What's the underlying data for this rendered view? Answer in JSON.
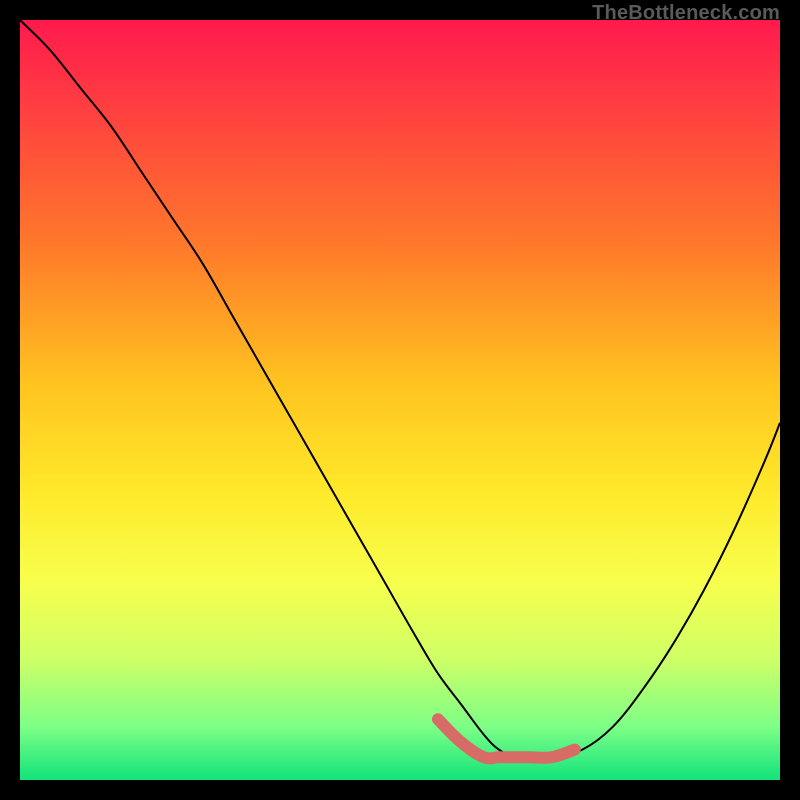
{
  "watermark": "TheBottleneck.com",
  "colors": {
    "gradient_stops": [
      "#ff1a4d 0%",
      "#ff4040 12%",
      "#ff7a2a 30%",
      "#ffc41f 48%",
      "#ffe92a 62%",
      "#f7ff4d 74%",
      "#cfff66 84%",
      "#7dff87 93%",
      "#12e37a 100%"
    ],
    "curve": "#000000",
    "highlight": "#d76b66",
    "frame": "#000000"
  },
  "chart_data": {
    "type": "line",
    "title": "",
    "xlabel": "",
    "ylabel": "",
    "xlim": [
      0,
      100
    ],
    "ylim": [
      0,
      100
    ],
    "series": [
      {
        "name": "bottleneck-curve",
        "x": [
          0,
          4,
          8,
          12,
          16,
          20,
          24,
          28,
          32,
          36,
          40,
          44,
          48,
          52,
          55,
          58,
          61,
          63,
          65,
          67,
          70,
          74,
          78,
          82,
          86,
          90,
          94,
          98,
          100
        ],
        "values": [
          100,
          96,
          91,
          86,
          80,
          74,
          68,
          61,
          54,
          47,
          40,
          33,
          26,
          19,
          14,
          10,
          6,
          4,
          3,
          3,
          3,
          4,
          7,
          12,
          18,
          25,
          33,
          42,
          47
        ]
      }
    ],
    "highlight_range": {
      "name": "optimal-zone",
      "x": [
        55,
        58,
        61,
        63,
        65,
        67,
        70,
        73
      ],
      "values": [
        8,
        5,
        3,
        3,
        3,
        3,
        3,
        4
      ]
    }
  }
}
